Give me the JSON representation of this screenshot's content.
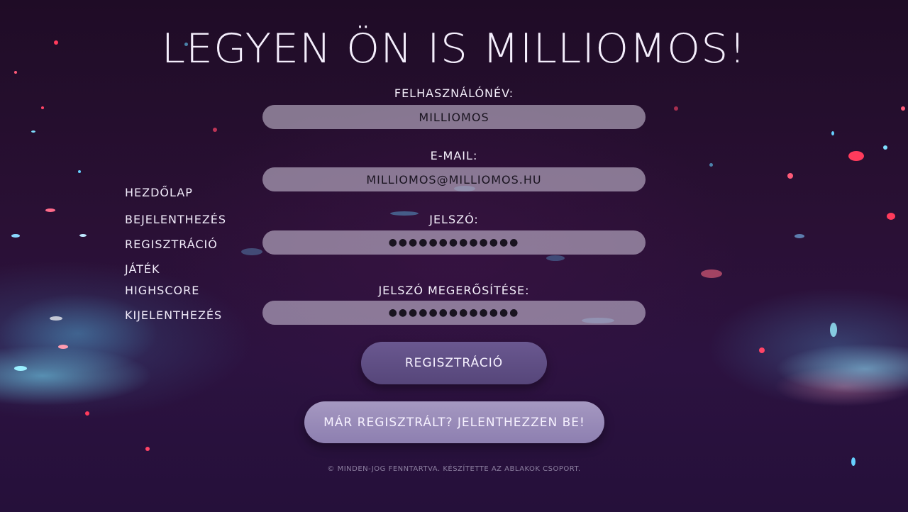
{
  "page": {
    "title": "LEGYEN ÖN IS MILLIOMOS!",
    "footer": "© MINDEN-JOG FENNTARTVA. KÉSZÍTETTE AZ ABLAKOK CSOPORT."
  },
  "nav": {
    "items": [
      {
        "label": "HEZDŐLAP"
      },
      {
        "label": "BEJELENTHEZÉS"
      },
      {
        "label": "REGISZTRÁCIÓ"
      },
      {
        "label": "JÁTÉK"
      },
      {
        "label": "HIGHSCORE"
      },
      {
        "label": "KIJELENTHEZÉS"
      }
    ]
  },
  "form": {
    "username": {
      "label": "FELHASZNÁLÓNÉV:",
      "value": "MILLIOMOS"
    },
    "email": {
      "label": "E-MAIL:",
      "value": "MILLIOMOS@MILLIOMOS.HU"
    },
    "password": {
      "label": "JELSZÓ:",
      "value": "●●●●●●●●●●●●●"
    },
    "password_confirm": {
      "label": "JELSZÓ MEGERŐSÍTÉSE:",
      "value": "●●●●●●●●●●●●●"
    },
    "register_button": "REGISZTRÁCIÓ",
    "login_link_button": "MÁR REGISZTRÁLT? JELENTHEZZEN BE!"
  },
  "colors": {
    "background": "#2a1035",
    "input_background": "#d7cde1",
    "primary_button": "#5e4d84",
    "secondary_button": "#9a8cb8",
    "text": "#f4eefc"
  }
}
